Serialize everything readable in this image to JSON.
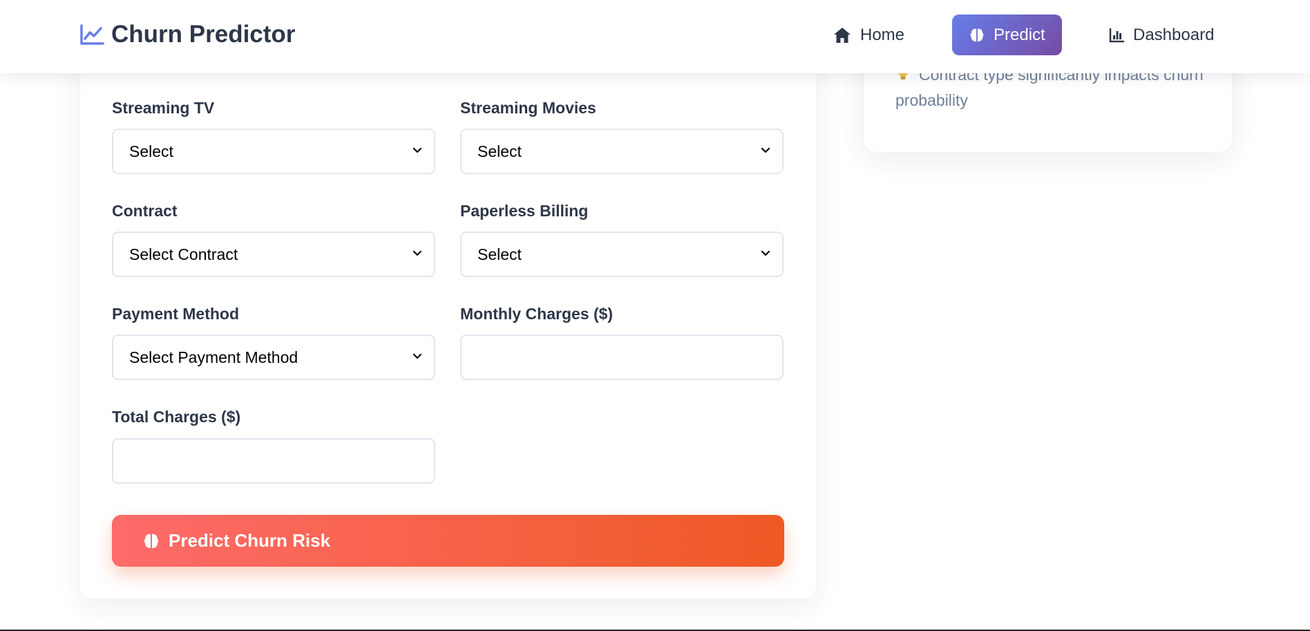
{
  "header": {
    "brand": "Churn Predictor",
    "nav": [
      {
        "label": "Home",
        "icon": "home-icon",
        "active": false
      },
      {
        "label": "Predict",
        "icon": "brain-icon",
        "active": true
      },
      {
        "label": "Dashboard",
        "icon": "bar-chart-icon",
        "active": false
      }
    ]
  },
  "form": {
    "streaming_tv": {
      "label": "Streaming TV",
      "value": "Select"
    },
    "streaming_movies": {
      "label": "Streaming Movies",
      "value": "Select"
    },
    "contract": {
      "label": "Contract",
      "value": "Select Contract"
    },
    "paperless_billing": {
      "label": "Paperless Billing",
      "value": "Select"
    },
    "payment_method": {
      "label": "Payment Method",
      "value": "Select Payment Method"
    },
    "monthly_charges": {
      "label": "Monthly Charges ($)",
      "value": ""
    },
    "total_charges": {
      "label": "Total Charges ($)",
      "value": ""
    },
    "submit_label": "Predict Churn Risk"
  },
  "info": {
    "tip_icon": "lightbulb-icon",
    "tip_text": "Contract type significantly impacts churn probability"
  },
  "colors": {
    "accent_start": "#667eea",
    "accent_end": "#764ba2",
    "cta_start": "#ff6b6b",
    "cta_end": "#ee5a24",
    "text_dark": "#2d3748",
    "text_muted": "#718096"
  }
}
